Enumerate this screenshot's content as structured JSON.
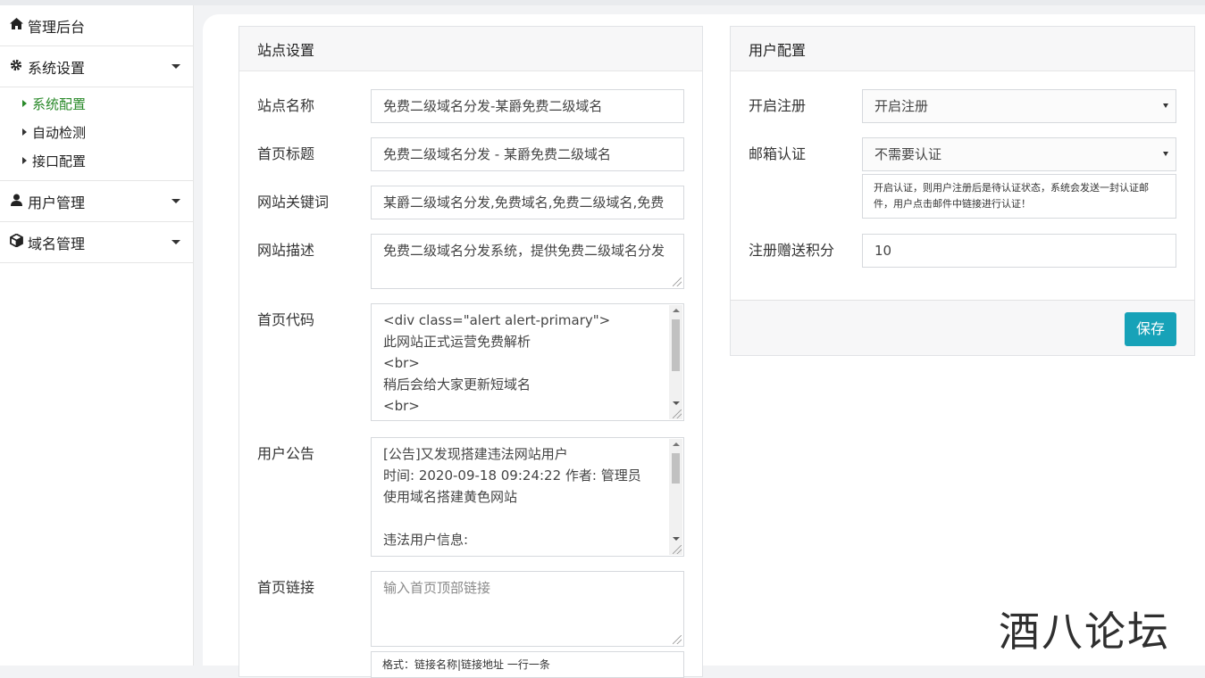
{
  "sidebar": {
    "title": "管理后台",
    "sections": [
      {
        "label": "系统设置",
        "icon": "gear-icon"
      },
      {
        "label": "用户管理",
        "icon": "user-icon"
      },
      {
        "label": "域名管理",
        "icon": "cube-icon"
      }
    ],
    "system_submenu": [
      "系统配置",
      "自动检测",
      "接口配置"
    ]
  },
  "site_settings": {
    "title": "站点设置",
    "fields": {
      "site_name": {
        "label": "站点名称",
        "value": "免费二级域名分发-某爵免费二级域名"
      },
      "home_title": {
        "label": "首页标题",
        "value": "免费二级域名分发 - 某爵免费二级域名"
      },
      "keywords": {
        "label": "网站关键词",
        "value": "某爵二级域名分发,免费域名,免费二级域名,免费"
      },
      "description": {
        "label": "网站描述",
        "value": "免费二级域名分发系统，提供免费二级域名分发"
      },
      "home_code": {
        "label": "首页代码",
        "lines": [
          "<div class=\"alert alert-primary\">",
          "此网站正式运营免费解析",
          "<br>",
          "稍后会给大家更新短域名",
          "<br>"
        ]
      },
      "announcement": {
        "label": "用户公告",
        "lines": [
          "[公告]又发现搭建违法网站用户",
          "时间: 2020-09-18 09:24:22 作者: 管理员",
          "使用域名搭建黄色网站",
          "",
          "违法用户信息:"
        ]
      },
      "home_links": {
        "label": "首页链接",
        "placeholder": "输入首页顶部链接",
        "hint_partial": "格式：链接名称|链接地址 一行一条"
      }
    }
  },
  "user_config": {
    "title": "用户配置",
    "fields": {
      "register": {
        "label": "开启注册",
        "value": "开启注册"
      },
      "email_verify": {
        "label": "邮箱认证",
        "value": "不需要认证",
        "hint": "开启认证，则用户注册后是待认证状态，系统会发送一封认证邮件，用户点击邮件中链接进行认证！"
      },
      "bonus_points": {
        "label": "注册赠送积分",
        "value": "10"
      }
    },
    "save_label": "保存"
  },
  "watermark": "酒八论坛",
  "colors": {
    "accent": "#17a2b8",
    "active_menu": "#2a8a2a"
  }
}
